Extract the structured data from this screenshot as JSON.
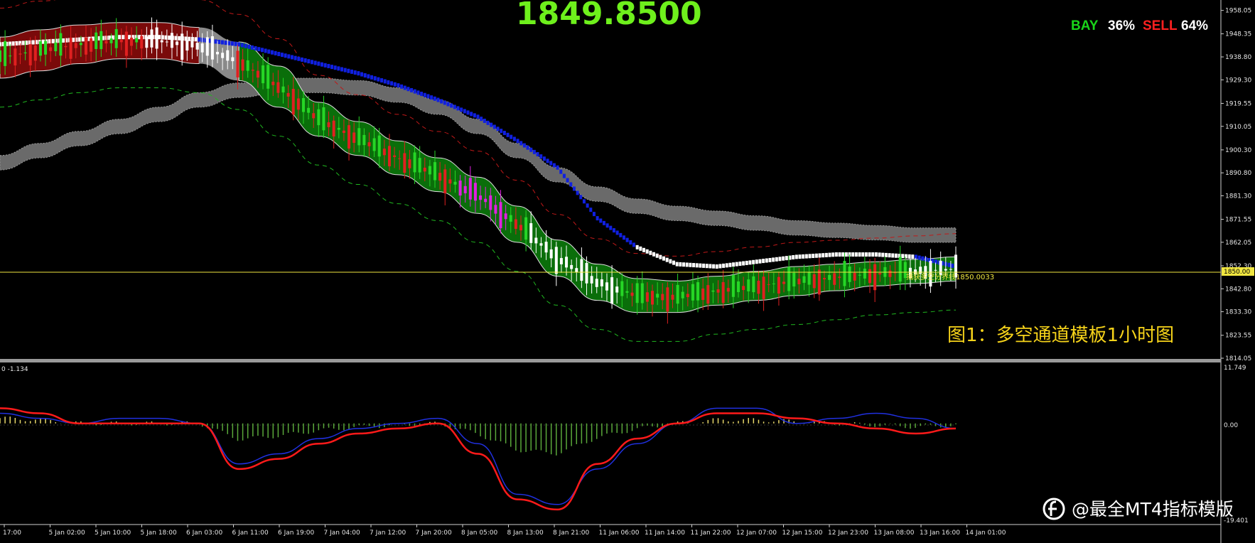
{
  "header": {
    "price": "1849.8500",
    "bay_label": "BAY",
    "bay_pct": "36%",
    "sell_label": "SELL",
    "sell_pct": "64%"
  },
  "colors": {
    "bay": "#19d419",
    "sell": "#ff2020",
    "pct": "#ffffff",
    "price": "#6ef01c",
    "caption": "#f6d31a",
    "bull_band": "#0a6e0a",
    "bear_band": "#7a0a0a",
    "gray_band": "#6a6a6a"
  },
  "caption": "图1：多空通道模板1小时图",
  "watermark": "@最全MT4指标模版",
  "chart_data": [
    {
      "type": "line",
      "title": "",
      "y_axis_ticks": [
        "1958.05",
        "1948.35",
        "1938.80",
        "1929.30",
        "1919.55",
        "1910.05",
        "1900.30",
        "1890.80",
        "1881.30",
        "1871.55",
        "1862.05",
        "1852.30",
        "1842.80",
        "1833.30",
        "1823.55",
        "1814.05"
      ],
      "ylim": [
        1814.05,
        1960.0
      ],
      "x_axis_ticks": [
        "17:00",
        "5 Jan 02:00",
        "5 Jan 10:00",
        "5 Jan 18:00",
        "6 Jan 03:00",
        "6 Jan 11:00",
        "6 Jan 19:00",
        "7 Jan 04:00",
        "7 Jan 12:00",
        "7 Jan 20:00",
        "8 Jan 05:00",
        "8 Jan 13:00",
        "8 Jan 21:00",
        "11 Jan 06:00",
        "11 Jan 14:00",
        "11 Jan 22:00",
        "12 Jan 07:00",
        "12 Jan 15:00",
        "12 Jan 23:00",
        "13 Jan 08:00",
        "13 Jan 16:00",
        "14 Jan 01:00"
      ],
      "current_price": "1850.00",
      "horizontal_line_label": "捕获多空分界线1850.0033",
      "horizontal_line_value": 1850.0033,
      "series": [
        {
          "values": [
            1947,
            1950,
            1952,
            1953,
            1953,
            1951,
            1945,
            1935,
            1920,
            1912,
            1904,
            1897,
            1889,
            1877,
            1863,
            1853,
            1847,
            1846,
            1848,
            1850,
            1852,
            1853,
            1854,
            1855,
            1856
          ]
        },
        {
          "values": [
            1930,
            1933,
            1936,
            1938,
            1938,
            1936,
            1929,
            1918,
            1906,
            1898,
            1890,
            1883,
            1874,
            1862,
            1848,
            1838,
            1833,
            1833,
            1836,
            1838,
            1840,
            1842,
            1844,
            1845,
            1846
          ]
        },
        {
          "values": [
            1895,
            1900,
            1905,
            1910,
            1915,
            1921,
            1925,
            1927,
            1927,
            1926,
            1923,
            1918,
            1910,
            1900,
            1890,
            1882,
            1877,
            1874,
            1872,
            1870,
            1868,
            1867,
            1866,
            1865,
            1865
          ]
        },
        {
          "values": [
            1944,
            1945,
            1946,
            1947,
            1947,
            1946,
            1944,
            1940,
            1936,
            1932,
            1927,
            1921,
            1914,
            1904,
            1893,
            1872,
            1860,
            1853,
            1852,
            1854,
            1856,
            1857,
            1857,
            1856,
            1852
          ]
        }
      ]
    },
    {
      "type": "bar",
      "title": "",
      "top_left_label": "0 -1.134",
      "y_axis_ticks": [
        "11.749",
        "0.00",
        "-19.401"
      ],
      "ylim": [
        -19.401,
        11.749
      ],
      "series": [
        {
          "values": [
            3,
            2,
            0,
            0,
            0,
            0,
            -9,
            -7,
            -4,
            -2,
            -1,
            0,
            -6,
            -15,
            -17,
            -8,
            -3,
            0,
            2,
            2,
            1,
            0,
            -1,
            -2,
            -1
          ]
        },
        {
          "values": [
            2,
            1,
            0,
            1,
            1,
            0,
            -8,
            -6,
            -3,
            -1,
            0,
            1,
            -4,
            -14,
            -16,
            -9,
            -4,
            0,
            3,
            3,
            0,
            1,
            2,
            1,
            -1
          ]
        }
      ]
    }
  ]
}
